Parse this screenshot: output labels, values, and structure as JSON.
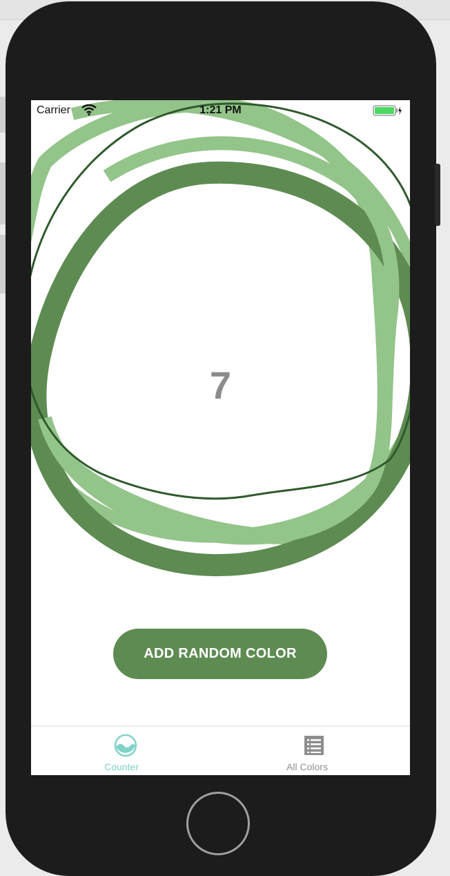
{
  "status_bar": {
    "carrier": "Carrier",
    "time": "1:21 PM",
    "wifi_icon": "wifi-icon",
    "battery_icon": "battery-charging-icon"
  },
  "counter": {
    "value": "7"
  },
  "actions": {
    "add_label": "ADD RANDOM COLOR"
  },
  "tabs": [
    {
      "label": "Counter",
      "icon": "wave-circle-icon",
      "selected": true
    },
    {
      "label": "All Colors",
      "icon": "list-icon",
      "selected": false
    }
  ],
  "colors": {
    "ring_dark": "#5e8b52",
    "ring_light": "#93c48a",
    "ring_outline": "#2f5a2c",
    "button": "#5e8b52",
    "tab_active": "#7fd3c9",
    "tab_inactive": "#8e8e8e",
    "counter_text": "#8c8c8c"
  }
}
